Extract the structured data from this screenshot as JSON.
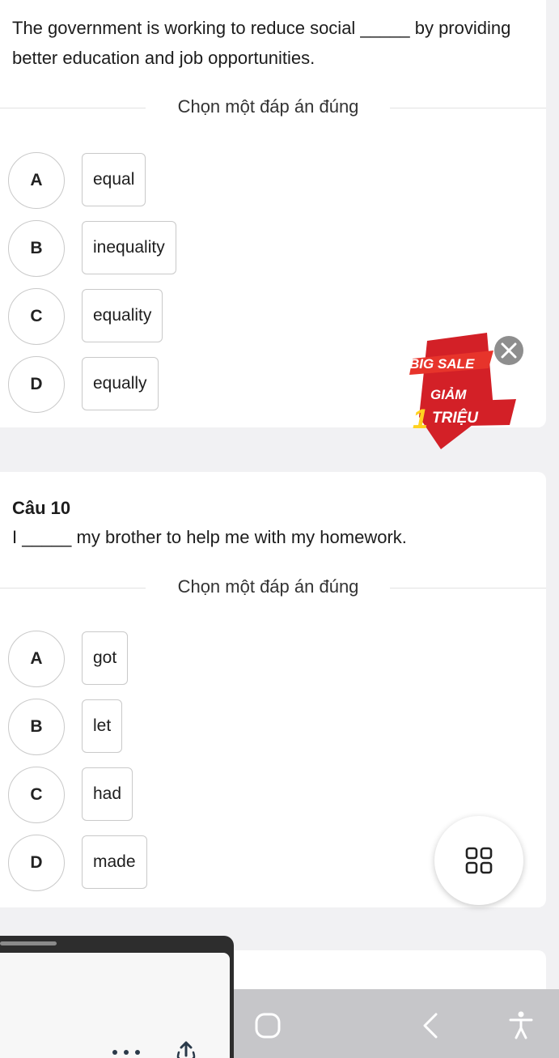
{
  "q9": {
    "text": "The government is working to reduce social _____ by providing better education and job opportunities.",
    "prompt": "Chọn một đáp án đúng",
    "options": [
      {
        "letter": "A",
        "text": "equal"
      },
      {
        "letter": "B",
        "text": "inequality"
      },
      {
        "letter": "C",
        "text": "equality"
      },
      {
        "letter": "D",
        "text": "equally"
      }
    ]
  },
  "q10": {
    "title": "Câu 10",
    "text": "I _____ my brother to help me with my homework.",
    "prompt": "Chọn một đáp án đúng",
    "options": [
      {
        "letter": "A",
        "text": "got"
      },
      {
        "letter": "B",
        "text": "let"
      },
      {
        "letter": "C",
        "text": "had"
      },
      {
        "letter": "D",
        "text": "made"
      }
    ]
  },
  "promo": {
    "line1": "BIG SALE",
    "line2": "GIẢM",
    "number": "1",
    "line3": "TRIỆU"
  },
  "colors": {
    "promo_red": "#d32027",
    "promo_yellow": "#ffd21f",
    "close_gray": "#7a7a7a"
  },
  "icons": [
    "close-icon",
    "grid-icon",
    "recents-icon",
    "home-icon",
    "back-icon",
    "accessibility-icon",
    "more-icon",
    "share-icon"
  ]
}
